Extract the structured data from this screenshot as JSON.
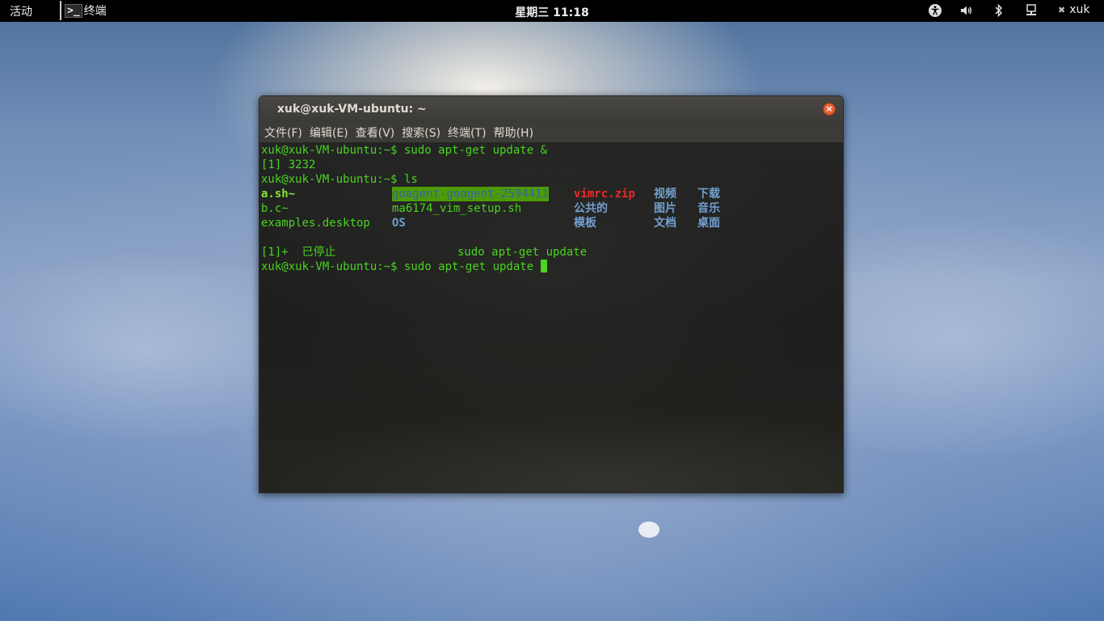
{
  "topbar": {
    "activities": "活动",
    "app_icon": "terminal-icon",
    "app_glyph": ">_",
    "app_name": "终端",
    "clock": "星期三 11:18",
    "tray_icons": [
      "accessibility-icon",
      "volume-icon",
      "bluetooth-icon",
      "network-icon"
    ],
    "user_name": "xuk"
  },
  "window": {
    "title": "xuk@xuk-VM-ubuntu: ~",
    "menu": [
      "文件(F)",
      "编辑(E)",
      "查看(V)",
      "搜索(S)",
      "终端(T)",
      "帮助(H)"
    ]
  },
  "terminal": {
    "lines": [
      "xuk@xuk-VM-ubuntu:~$ sudo apt-get update &",
      "[1] 3232",
      "xuk@xuk-VM-ubuntu:~$ ls"
    ],
    "ls_rows": [
      [
        "a.sh~",
        "goagent-goagent-2594411",
        "vimrc.zip",
        "视频",
        "下载"
      ],
      [
        "b.c~",
        "ma6174_vim_setup.sh",
        "公共的",
        "图片",
        "音乐"
      ],
      [
        "examples.desktop",
        "OS",
        "模板",
        "文档",
        "桌面"
      ]
    ],
    "job_line": {
      "job": "[1]+  已停止",
      "command": "sudo apt-get update"
    },
    "prompt_line": "xuk@xuk-VM-ubuntu:~$ sudo apt-get update "
  },
  "colors": {
    "terminal_green": "#4ad320",
    "dir_blue": "#729fcf",
    "archive_red": "#ef2929",
    "highlight_bg": "#4e9a06"
  }
}
